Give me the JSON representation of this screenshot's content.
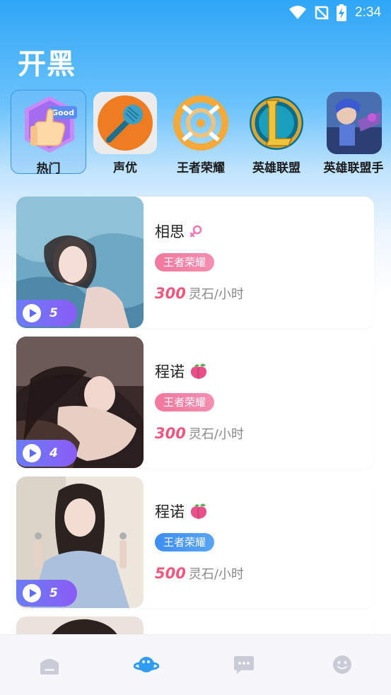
{
  "status": {
    "time": "2:34"
  },
  "page": {
    "title": "开黑"
  },
  "categories": [
    {
      "label": "热门",
      "icon": "thumbs-up-good-icon",
      "active": true
    },
    {
      "label": "声优",
      "icon": "microphone-icon",
      "active": false
    },
    {
      "label": "王者荣耀",
      "icon": "honor-of-kings-logo-icon",
      "active": false
    },
    {
      "label": "英雄联盟",
      "icon": "league-of-legends-logo-icon",
      "active": false
    },
    {
      "label": "英雄联盟手",
      "icon": "lol-mobile-game-icon",
      "active": false
    }
  ],
  "cards": [
    {
      "name": "相思",
      "name_icon": "female-symbol-icon",
      "tag": "王者荣耀",
      "tag_color": "#f1779e",
      "price": "300",
      "unit": "灵石/小时",
      "play_count": "5"
    },
    {
      "name": "程诺",
      "name_icon": "peach-icon",
      "tag": "王者荣耀",
      "tag_color": "#f1779e",
      "price": "300",
      "unit": "灵石/小时",
      "play_count": "4"
    },
    {
      "name": "程诺",
      "name_icon": "peach-icon",
      "tag": "王者荣耀",
      "tag_color": "#3d8ef0",
      "price": "500",
      "unit": "灵石/小时",
      "play_count": "5"
    }
  ],
  "bottom_nav": [
    {
      "icon": "home-icon",
      "active": false
    },
    {
      "icon": "planet-icon",
      "active": true
    },
    {
      "icon": "chat-bubble-icon",
      "active": false
    },
    {
      "icon": "smiley-icon",
      "active": false
    }
  ],
  "colors": {
    "accent": "#2fa6f6",
    "price": "#f0577f",
    "tag_pink": "#f1779e",
    "tag_blue": "#3d8ef0"
  }
}
